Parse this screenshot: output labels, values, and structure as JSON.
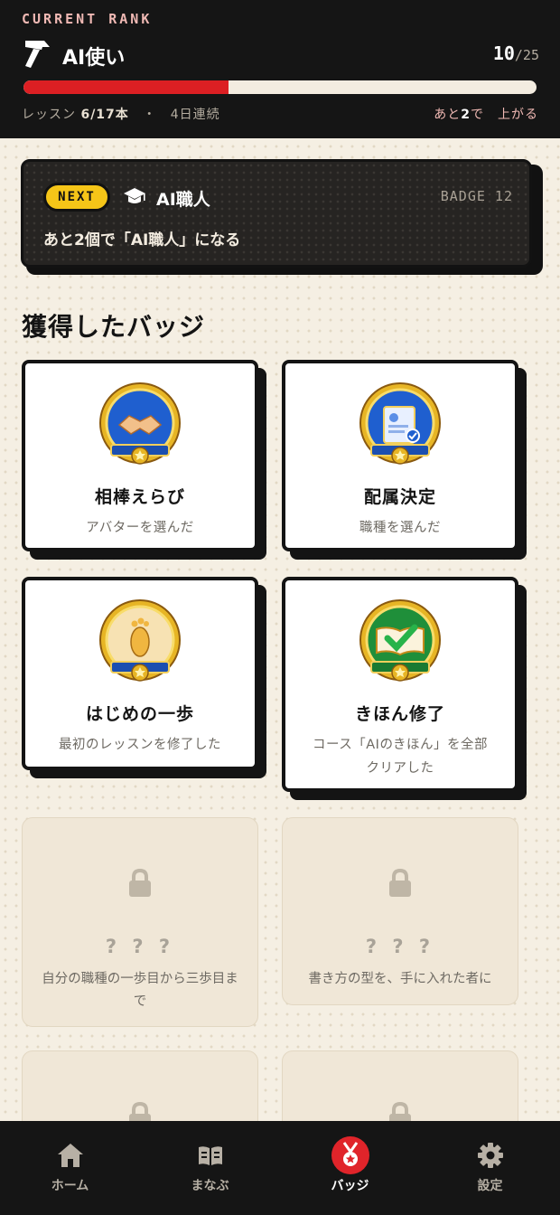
{
  "rank": {
    "caption": "CURRENT RANK",
    "icon": "hammer-icon",
    "title": "AI使い",
    "current": "10",
    "total": "/25",
    "progress_fraction": 0.4,
    "lessons_label": "レッスン",
    "lessons_value": "6/17本",
    "separator": "・",
    "streak": "4日連続",
    "remaining_prefix": "あと",
    "remaining_count": "2",
    "remaining_suffix": "で　上がる"
  },
  "next": {
    "pill": "NEXT",
    "icon": "graduation-cap-icon",
    "title": "AI職人",
    "badge_label": "BADGE 12",
    "desc": "あと2個で「AI職人」になる"
  },
  "badges": {
    "section_title": "獲得したバッジ",
    "earned": [
      {
        "name": "相棒えらび",
        "desc": "アバターを選んだ",
        "icon": "handshake-medal-icon"
      },
      {
        "name": "配属決定",
        "desc": "職種を選んだ",
        "icon": "id-card-medal-icon"
      },
      {
        "name": "はじめの一歩",
        "desc": "最初のレッスンを修了した",
        "icon": "footprint-medal-icon"
      },
      {
        "name": "きほん修了",
        "desc": "コース「AIのきほん」を全部クリアした",
        "icon": "book-check-medal-icon"
      }
    ],
    "locked": [
      {
        "name": "? ? ?",
        "desc": "自分の職種の一歩目から三歩目まで",
        "icon": "lock-icon"
      },
      {
        "name": "? ? ?",
        "desc": "書き方の型を、手に入れた者に",
        "icon": "lock-icon"
      },
      {
        "name": "",
        "desc": "",
        "icon": "lock-icon"
      },
      {
        "name": "",
        "desc": "",
        "icon": "lock-icon"
      }
    ]
  },
  "tabs": [
    {
      "label": "ホーム",
      "icon": "home-icon"
    },
    {
      "label": "まなぶ",
      "icon": "book-icon"
    },
    {
      "label": "バッジ",
      "icon": "medal-icon",
      "active": true
    },
    {
      "label": "設定",
      "icon": "gear-icon"
    }
  ],
  "colors": {
    "accent_red": "#dc1f23",
    "next_yellow": "#f5c518",
    "dark": "#151515",
    "cream": "#f5efe3"
  }
}
